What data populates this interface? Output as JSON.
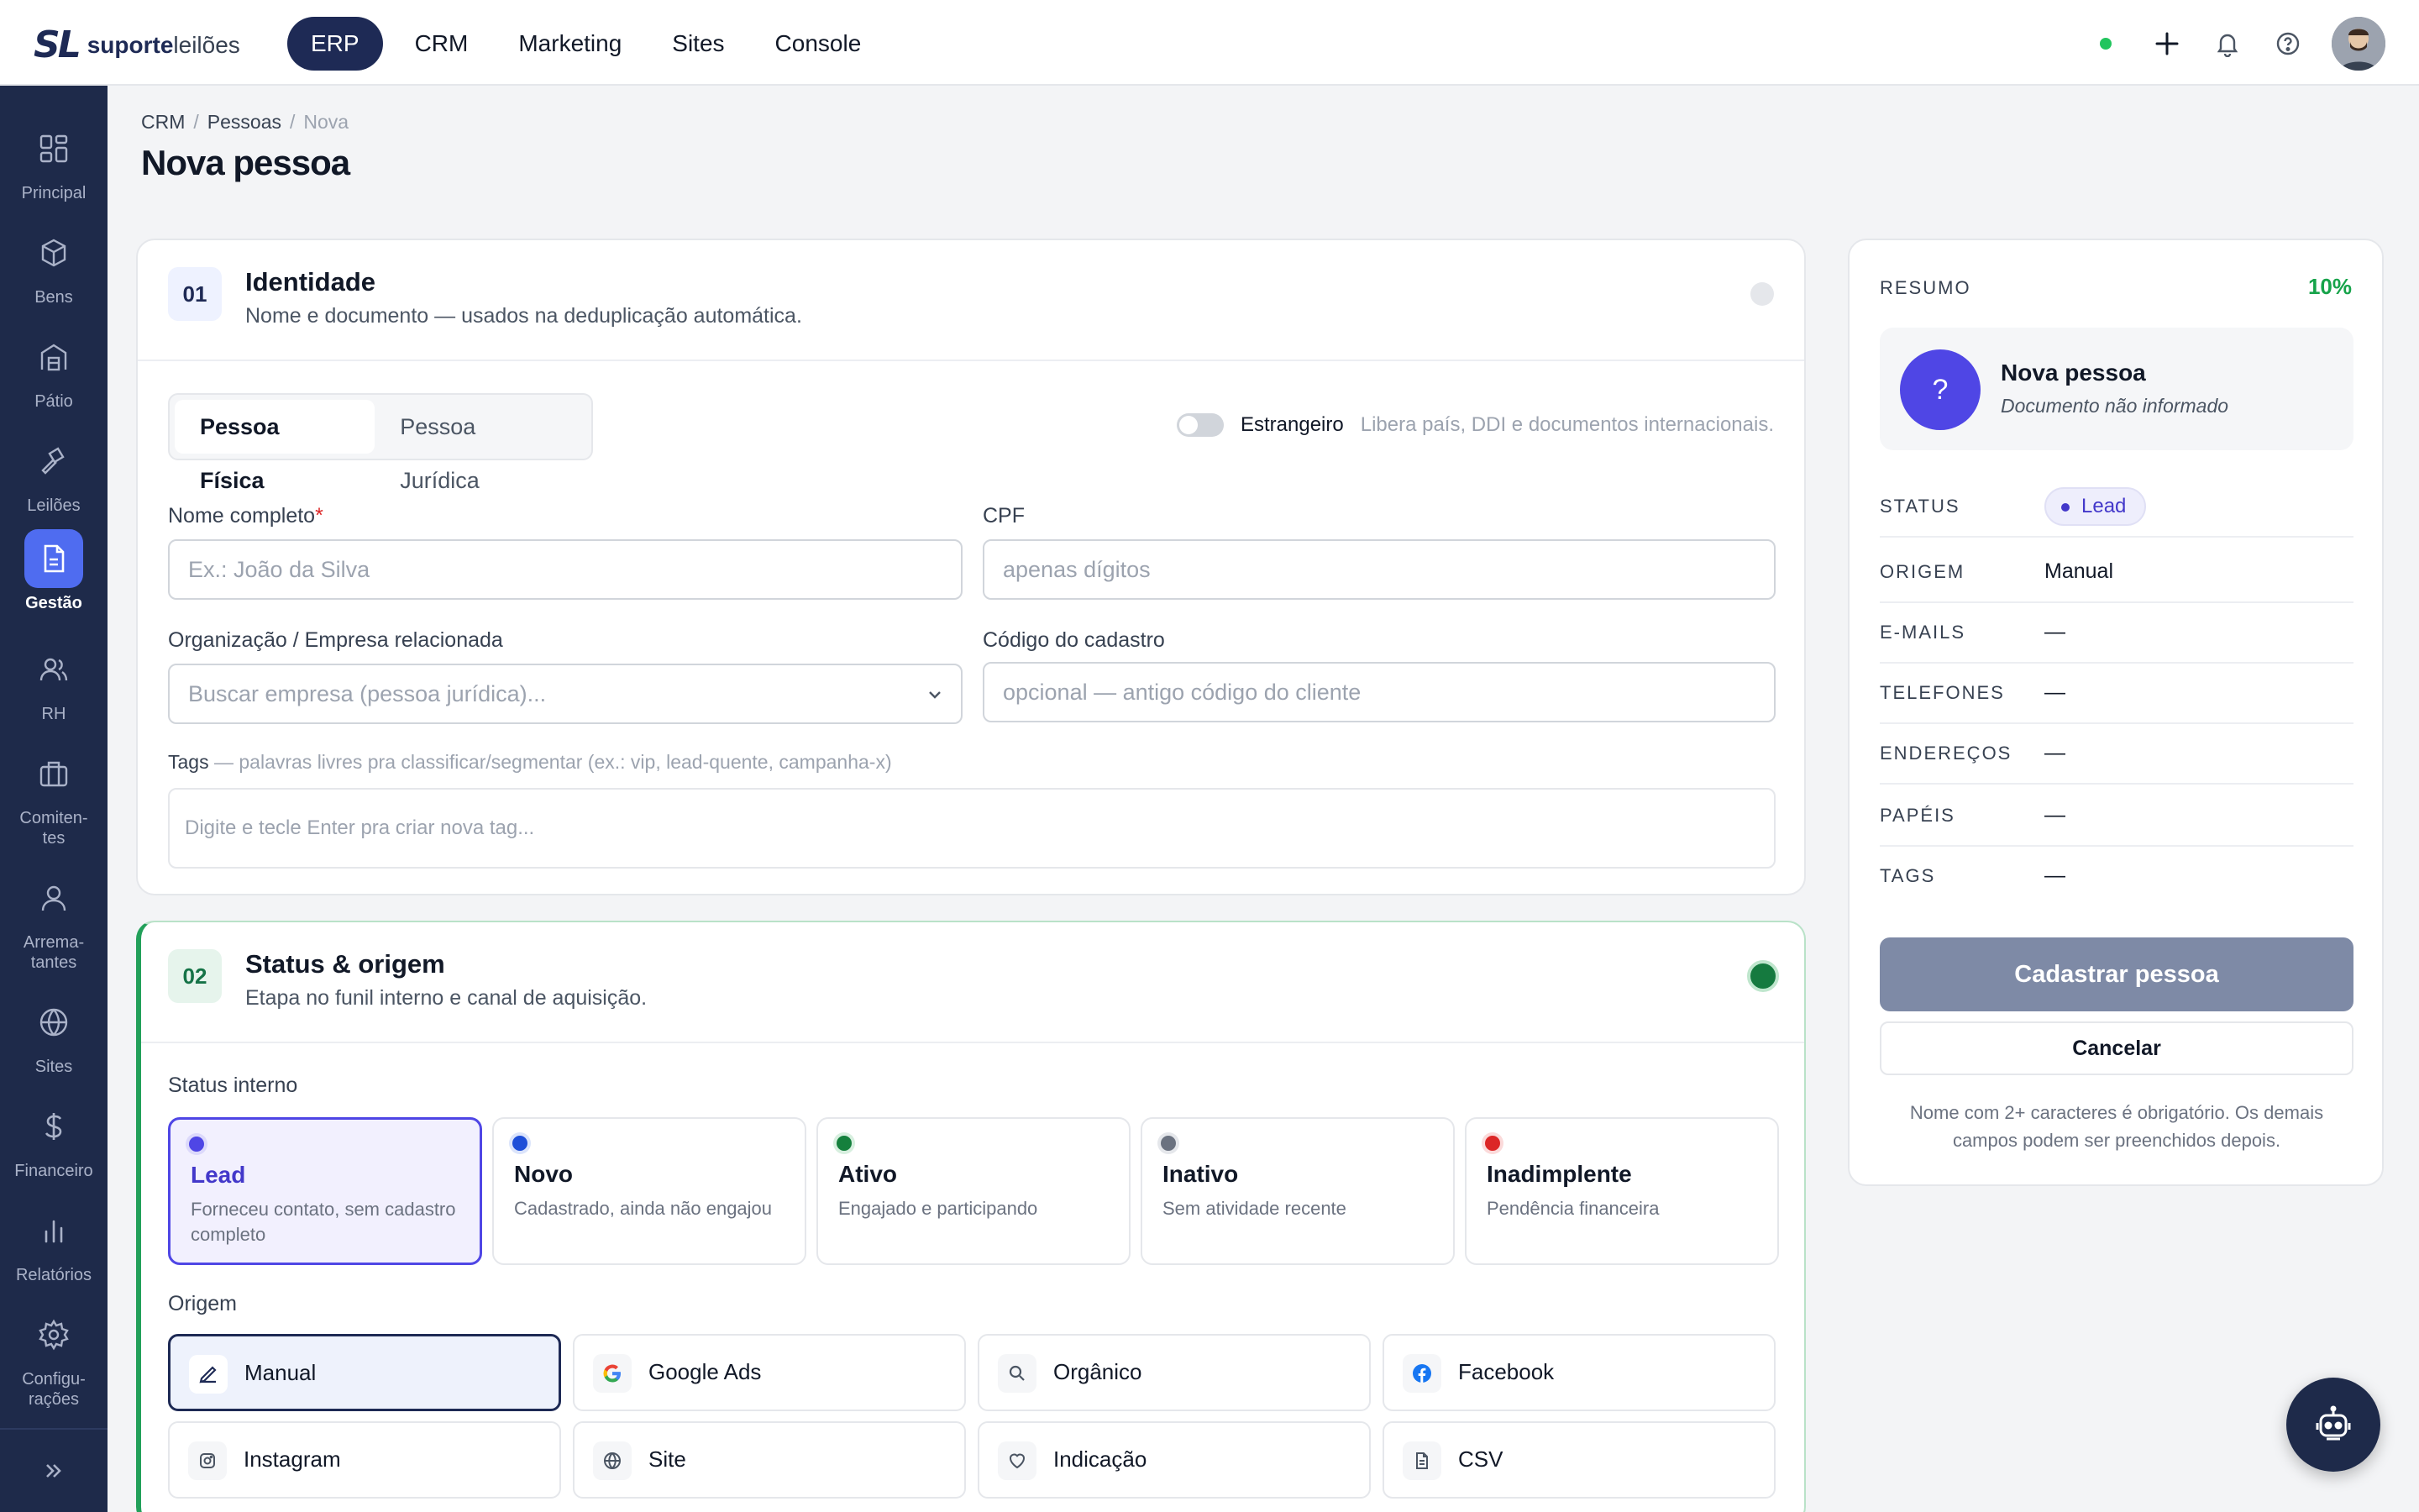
{
  "brand": {
    "mark": "SL",
    "name_bold": "suporte",
    "name_light": "leilões"
  },
  "nav": [
    {
      "label": "ERP",
      "active": true
    },
    {
      "label": "CRM"
    },
    {
      "label": "Marketing"
    },
    {
      "label": "Sites"
    },
    {
      "label": "Console"
    }
  ],
  "sidebar": [
    {
      "label": "Principal",
      "icon": "grid-icon"
    },
    {
      "label": "Bens",
      "icon": "box-icon"
    },
    {
      "label": "Pátio",
      "icon": "warehouse-icon"
    },
    {
      "label": "Leilões",
      "icon": "gavel-icon"
    },
    {
      "label": "Gestão",
      "icon": "document-icon",
      "active": true
    },
    {
      "label": "RH",
      "icon": "users-icon"
    },
    {
      "label": "Comiten-",
      "label2": "tes",
      "icon": "briefcase-icon"
    },
    {
      "label": "Arrema-",
      "label2": "tantes",
      "icon": "user-icon"
    },
    {
      "label": "Sites",
      "icon": "globe-icon"
    },
    {
      "label": "Financeiro",
      "icon": "dollar-icon"
    },
    {
      "label": "Relatórios",
      "icon": "bar-chart-icon"
    },
    {
      "label": "Configu-",
      "label2": "rações",
      "icon": "gear-icon"
    }
  ],
  "breadcrumb": {
    "a": "CRM",
    "b": "Pessoas",
    "c": "Nova"
  },
  "page_title": "Nova pessoa",
  "identity": {
    "num": "01",
    "title": "Identidade",
    "subtitle": "Nome e documento — usados na deduplicação automática.",
    "tab_pf": "Pessoa Física",
    "tab_pj": "Pessoa Jurídica",
    "toggle_label": "Estrangeiro",
    "toggle_hint": "Libera país, DDI e documentos internacionais.",
    "name_label": "Nome completo",
    "name_req": "*",
    "name_placeholder": "Ex.: João da Silva",
    "cpf_label": "CPF",
    "cpf_placeholder": "apenas dígitos",
    "org_label": "Organização / Empresa relacionada",
    "org_placeholder": "Buscar empresa (pessoa jurídica)...",
    "code_label": "Código do cadastro",
    "code_placeholder": "opcional — antigo código do cliente",
    "tags_label": "Tags",
    "tags_hint": " — palavras livres pra classificar/segmentar (ex.: vip, lead-quente, campanha-x)",
    "tags_placeholder": "Digite e tecle Enter pra criar nova tag..."
  },
  "status": {
    "num": "02",
    "title": "Status & origem",
    "subtitle": "Etapa no funil interno e canal de aquisição.",
    "status_label": "Status interno",
    "items": [
      {
        "name": "Lead",
        "desc": "Forneceu contato, sem cadastro completo",
        "color": "#4f46e5"
      },
      {
        "name": "Novo",
        "desc": "Cadastrado, ainda não engajou",
        "color": "#1d4ed8"
      },
      {
        "name": "Ativo",
        "desc": "Engajado e participando",
        "color": "#15803d"
      },
      {
        "name": "Inativo",
        "desc": "Sem atividade recente",
        "color": "#6b7280"
      },
      {
        "name": "Inadimplente",
        "desc": "Pendência financeira",
        "color": "#dc2626"
      }
    ],
    "origin_label": "Origem",
    "origins": [
      {
        "name": "Manual",
        "icon": "pencil-icon"
      },
      {
        "name": "Google Ads",
        "icon": "google-icon"
      },
      {
        "name": "Orgânico",
        "icon": "search-icon"
      },
      {
        "name": "Facebook",
        "icon": "facebook-icon"
      },
      {
        "name": "Instagram",
        "icon": "instagram-icon"
      },
      {
        "name": "Site",
        "icon": "globe-icon"
      },
      {
        "name": "Indicação",
        "icon": "heart-icon"
      },
      {
        "name": "CSV",
        "icon": "file-icon"
      }
    ]
  },
  "resumo": {
    "title": "RESUMO",
    "pct": "10%",
    "avatar": "?",
    "name": "Nova pessoa",
    "doc": "Documento não informado",
    "rows": [
      {
        "key": "STATUS",
        "val": "Lead"
      },
      {
        "key": "ORIGEM",
        "val": "Manual"
      },
      {
        "key": "E-MAILS",
        "val": "—"
      },
      {
        "key": "TELEFONES",
        "val": "—"
      },
      {
        "key": "ENDEREÇOS",
        "val": "—"
      },
      {
        "key": "PAPÉIS",
        "val": "—"
      },
      {
        "key": "TAGS",
        "val": "—"
      }
    ],
    "submit": "Cadastrar pessoa",
    "cancel": "Cancelar",
    "note": "Nome com 2+ caracteres é obrigatório. Os demais campos podem ser preenchidos depois."
  }
}
